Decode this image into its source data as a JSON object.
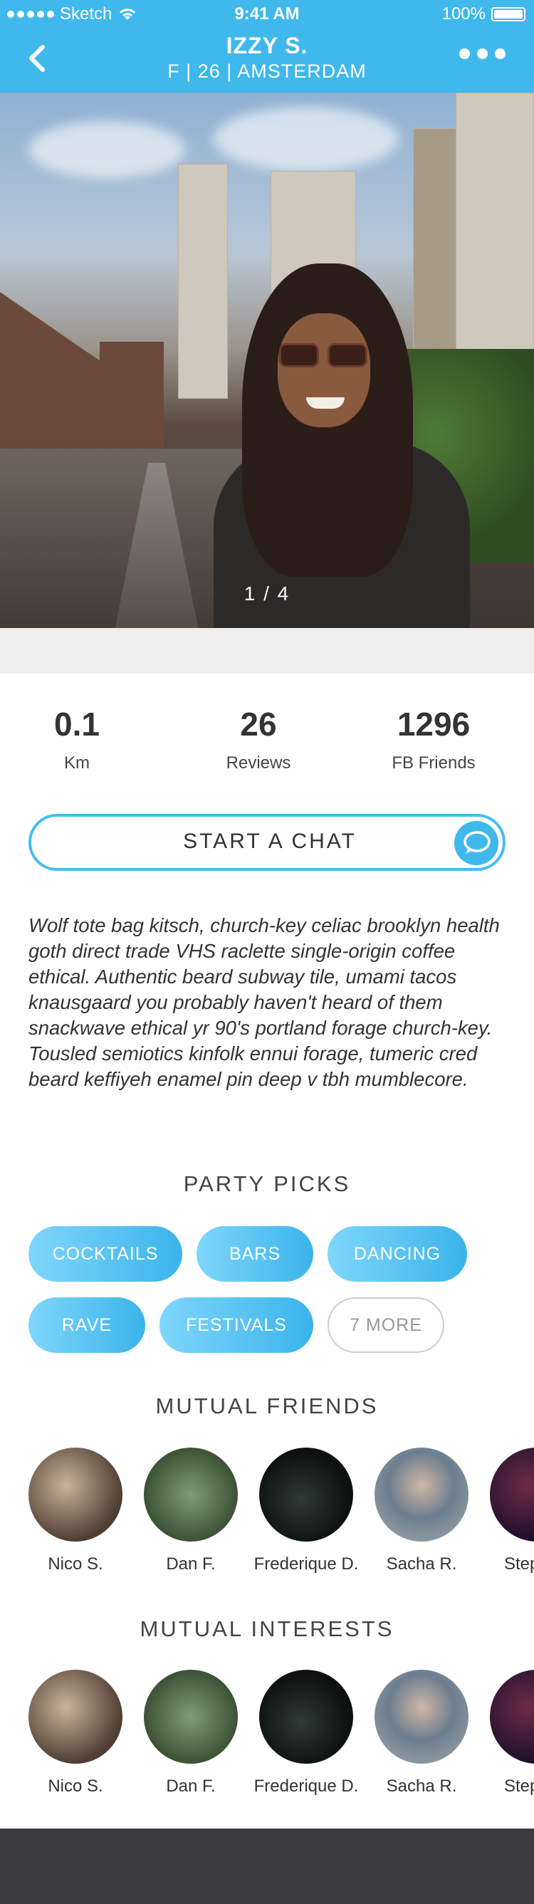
{
  "status_bar": {
    "carrier": "Sketch",
    "time": "9:41 AM",
    "battery": "100%"
  },
  "header": {
    "name": "IZZY S.",
    "details": "F | 26 | AMSTERDAM"
  },
  "photo": {
    "counter": "1 / 4"
  },
  "stats": [
    {
      "value": "0.1",
      "label": "Km"
    },
    {
      "value": "26",
      "label": "Reviews"
    },
    {
      "value": "1296",
      "label": "FB Friends"
    }
  ],
  "chat_button": {
    "label": "START A CHAT"
  },
  "bio": "Wolf tote bag kitsch, church-key celiac brooklyn health goth direct trade VHS raclette single-origin coffee ethical. Authentic beard subway tile, umami tacos knausgaard you probably haven't heard of them snackwave ethical yr 90's portland forage church-key. Tousled semiotics kinfolk ennui forage, tumeric cred beard keffiyeh enamel pin deep v tbh mumblecore.",
  "party_picks": {
    "title": "PARTY PICKS",
    "items": [
      "COCKTAILS",
      "BARS",
      "DANCING",
      "RAVE",
      "FESTIVALS"
    ],
    "more": "7 MORE"
  },
  "mutual_friends": {
    "title": "MUTUAL FRIENDS",
    "people": [
      "Nico S.",
      "Dan F.",
      "Frederique D.",
      "Sacha R.",
      "Step"
    ]
  },
  "mutual_interests": {
    "title": "MUTUAL INTERESTS",
    "people": [
      "Nico S.",
      "Dan F.",
      "Frederique D.",
      "Sacha R.",
      "Step"
    ]
  },
  "colors": {
    "accent": "#3fb8ec",
    "footer": "#3c3c3e"
  }
}
